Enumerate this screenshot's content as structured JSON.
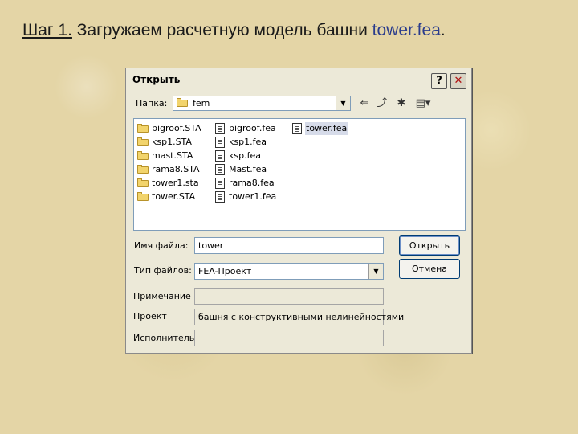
{
  "slide": {
    "step": "Шаг 1.",
    "text": " Загружаем расчетную модель башни ",
    "file": "tower.fea",
    "period": "."
  },
  "dialog": {
    "title": "Открыть",
    "help_label": "?",
    "close_label": "✕",
    "folder_label": "Папка:",
    "folder_value": "fem",
    "files": [
      {
        "name": "bigroof.STA",
        "type": "folder"
      },
      {
        "name": "ksp1.STA",
        "type": "folder"
      },
      {
        "name": "mast.STA",
        "type": "folder"
      },
      {
        "name": "rama8.STA",
        "type": "folder"
      },
      {
        "name": "tower1.sta",
        "type": "folder"
      },
      {
        "name": "tower.STA",
        "type": "folder"
      },
      {
        "name": "bigroof.fea",
        "type": "file"
      },
      {
        "name": "ksp1.fea",
        "type": "file"
      },
      {
        "name": "ksp.fea",
        "type": "file"
      },
      {
        "name": "Mast.fea",
        "type": "file"
      },
      {
        "name": "rama8.fea",
        "type": "file"
      },
      {
        "name": "tower1.fea",
        "type": "file"
      },
      {
        "name": "tower.fea",
        "type": "file",
        "selected": true
      }
    ],
    "filename_label": "Имя файла:",
    "filename_value": "tower",
    "filetype_label": "Тип файлов:",
    "filetype_value": "FEA-Проект",
    "note_label": "Примечание",
    "note_value": "",
    "project_label": "Проект",
    "project_value": "башня с конструктивными нелинейностями",
    "author_label": "Исполнитель",
    "author_value": "",
    "open_button": "Открыть",
    "cancel_button": "Отмена"
  }
}
